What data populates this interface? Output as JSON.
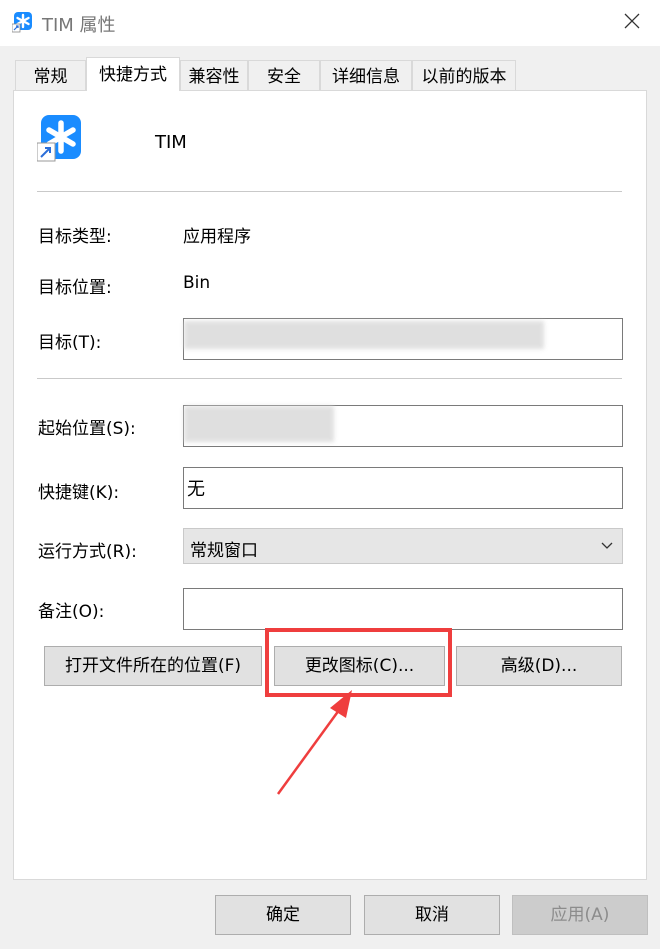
{
  "window": {
    "title": "TIM 属性"
  },
  "tabs": [
    {
      "label": "常规"
    },
    {
      "label": "快捷方式"
    },
    {
      "label": "兼容性"
    },
    {
      "label": "安全"
    },
    {
      "label": "详细信息"
    },
    {
      "label": "以前的版本"
    }
  ],
  "shortcut": {
    "name": "TIM"
  },
  "fields": {
    "target_type_label": "目标类型:",
    "target_type_value": "应用程序",
    "target_location_label": "目标位置:",
    "target_location_value": "Bin",
    "target_label": "目标(T):",
    "start_in_label": "起始位置(S):",
    "hotkey_label": "快捷键(K):",
    "hotkey_value": "无",
    "run_label": "运行方式(R):",
    "run_value": "常规窗口",
    "comment_label": "备注(O):"
  },
  "buttons": {
    "open_location": "打开文件所在的位置(F)",
    "change_icon": "更改图标(C)...",
    "advanced": "高级(D)..."
  },
  "footer": {
    "ok": "确定",
    "cancel": "取消",
    "apply": "应用(A)"
  },
  "colors": {
    "accent_icon": "#1a8cff",
    "highlight": "#ef3e3e"
  }
}
